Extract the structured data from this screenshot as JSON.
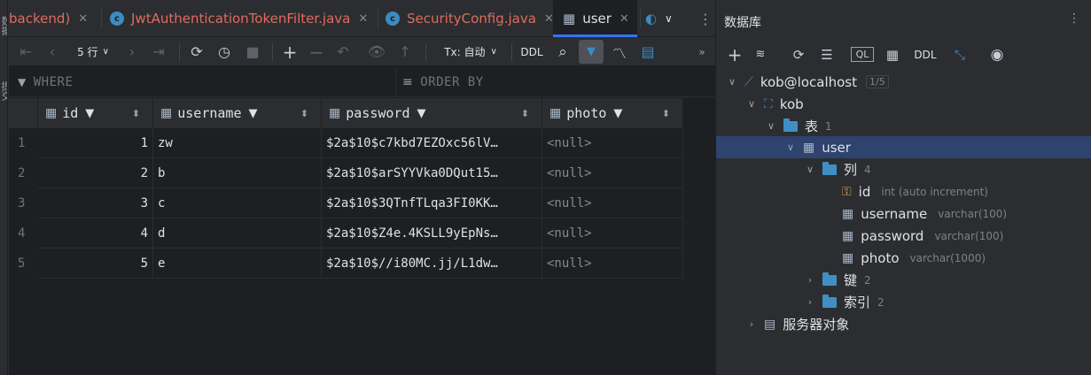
{
  "left_strip": {
    "labels": [
      "数据",
      "提交"
    ]
  },
  "tabs": [
    {
      "label": "backend)"
    },
    {
      "label": "JwtAuthenticationTokenFilter.java"
    },
    {
      "label": "SecurityConfig.java"
    },
    {
      "label": "user"
    }
  ],
  "toolbar": {
    "rows_label": "5 行",
    "tx_label": "Tx: 自动",
    "ddl_label": "DDL"
  },
  "filter": {
    "where_label": "WHERE",
    "orderby_label": "ORDER BY"
  },
  "grid": {
    "columns": [
      "id",
      "username",
      "password",
      "photo"
    ],
    "rows": [
      {
        "num": "1",
        "id": "1",
        "username": "zw",
        "password": "$2a$10$c7kbd7EZOxc56lV…",
        "photo": "<null>"
      },
      {
        "num": "2",
        "id": "2",
        "username": "b",
        "password": "$2a$10$arSYYVka0DQut15…",
        "photo": "<null>"
      },
      {
        "num": "3",
        "id": "3",
        "username": "c",
        "password": "$2a$10$3QTnfTLqa3FI0KK…",
        "photo": "<null>"
      },
      {
        "num": "4",
        "id": "4",
        "username": "d",
        "password": "$2a$10$Z4e.4KSLL9yEpNs…",
        "photo": "<null>"
      },
      {
        "num": "5",
        "id": "5",
        "username": "e",
        "password": "$2a$10$//i80MC.jj/L1dw…",
        "photo": "<null>"
      }
    ]
  },
  "db_panel": {
    "title": "数据库",
    "ddl_label": "DDL",
    "tree": {
      "connection": "kob@localhost",
      "connection_badge": "1/5",
      "schema": "kob",
      "tables_label": "表",
      "tables_count": "1",
      "table": "user",
      "columns_label": "列",
      "columns_count": "4",
      "columns": [
        {
          "name": "id",
          "type": "int (auto increment)"
        },
        {
          "name": "username",
          "type": "varchar(100)"
        },
        {
          "name": "password",
          "type": "varchar(100)"
        },
        {
          "name": "photo",
          "type": "varchar(1000)"
        }
      ],
      "keys_label": "键",
      "keys_count": "2",
      "indexes_label": "索引",
      "indexes_count": "2",
      "server_objects_label": "服务器对象"
    }
  },
  "colors": {
    "accent": "#3574f0",
    "selection": "#2e436e",
    "tab_error_text": "#e06c5b",
    "folder": "#3f8fc4"
  }
}
